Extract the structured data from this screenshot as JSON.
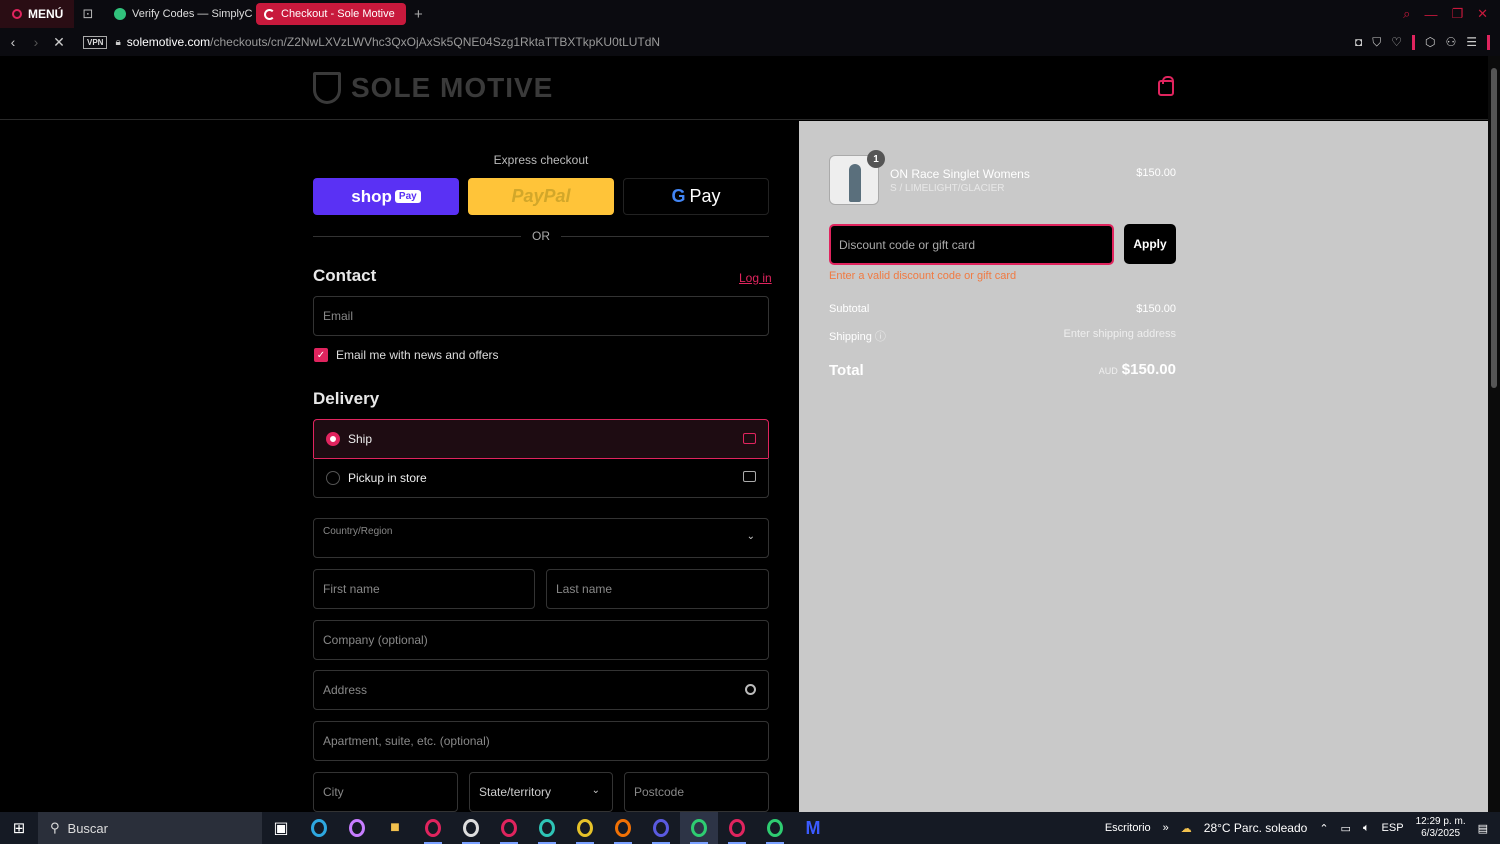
{
  "browser": {
    "menu_label": "MENÚ",
    "tabs": [
      {
        "label": "Verify Codes — SimplyCo"
      },
      {
        "label": "Checkout - Sole Motive"
      }
    ],
    "url_host": "solemotive.com",
    "url_path": "/checkouts/cn/Z2NwLXVzLWVhc3QxOjAxSk5QNE04Szg1RktaTTBXTkpKU0tLUTdN",
    "vpn_label": "VPN"
  },
  "site": {
    "logo_text": "SOLE MOTIVE"
  },
  "express": {
    "title": "Express checkout",
    "shop_label": "shop",
    "shop_pay_badge": "Pay",
    "paypal_label": "PayPal",
    "gpay_g": "G",
    "gpay_label": "Pay",
    "or_label": "OR"
  },
  "contact": {
    "title": "Contact",
    "login_link": "Log in",
    "email_placeholder": "Email",
    "newsletter_label": "Email me with news and offers",
    "newsletter_checked": true
  },
  "delivery": {
    "title": "Delivery",
    "options": [
      {
        "label": "Ship",
        "selected": true
      },
      {
        "label": "Pickup in store",
        "selected": false
      }
    ],
    "country_label": "Country/Region",
    "first_name": "First name",
    "last_name": "Last name",
    "company": "Company (optional)",
    "address": "Address",
    "apartment": "Apartment, suite, etc. (optional)",
    "city": "City",
    "state": "State/territory",
    "postcode": "Postcode"
  },
  "summary": {
    "product": {
      "name": "ON Race Singlet Womens",
      "variant": "S / LIMELIGHT/GLACIER",
      "price": "$150.00",
      "quantity": "1"
    },
    "discount_placeholder": "Discount code or gift card",
    "apply_label": "Apply",
    "discount_error": "Enter a valid discount code or gift card",
    "subtotal_label": "Subtotal",
    "subtotal_value": "$150.00",
    "shipping_label": "Shipping",
    "shipping_value": "Enter shipping address",
    "total_label": "Total",
    "total_currency": "AUD",
    "total_value": "$150.00"
  },
  "taskbar": {
    "search_label": "Buscar",
    "desktop_label": "Escritorio",
    "weather": "28°C  Parc. soleado",
    "language": "ESP",
    "time": "12:29 p. m.",
    "date": "6/3/2025"
  },
  "colors": {
    "accent": "#e0245e",
    "summary_bg": "#c9c9c9",
    "shop_pay": "#5a31f4",
    "paypal": "#ffc439",
    "error": "#f07a42"
  }
}
